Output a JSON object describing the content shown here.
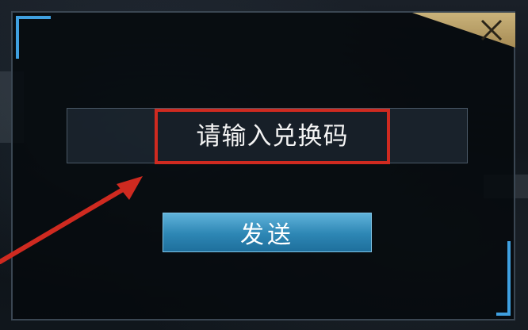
{
  "dialog": {
    "close_icon": "close-x-icon",
    "input": {
      "placeholder": "请输入兑换码",
      "value": ""
    },
    "send_label": "发送"
  },
  "annotation": {
    "highlight_color": "#cf2a20",
    "arrow_color": "#cf2a20"
  },
  "colors": {
    "button": "#2d86b4",
    "frame_accent": "#3fa0e0",
    "close_tab": "#c9b27a"
  }
}
